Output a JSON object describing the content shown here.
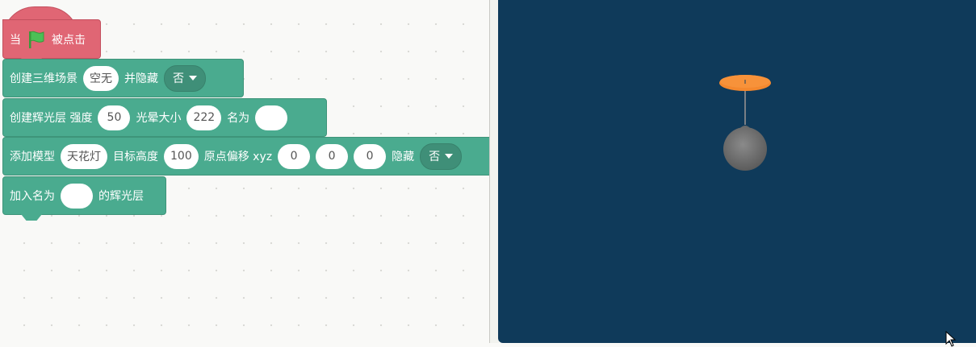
{
  "blocks": {
    "hat": {
      "prefix": "当",
      "suffix": "被点击",
      "flag_icon": "green-flag-icon",
      "color": "#e06674"
    },
    "scene": {
      "label": "创建三维场景",
      "scene_value": "空无",
      "hide_label": "并隐藏",
      "hide_value": "否"
    },
    "glow": {
      "label": "创建辉光层 强度",
      "strength": "50",
      "halo_label": "光晕大小",
      "halo": "222",
      "name_label": "名为",
      "name_value": ""
    },
    "model": {
      "label": "添加模型",
      "model_value": "天花灯",
      "height_label": "目标高度",
      "height": "100",
      "offset_label": "原点偏移 xyz",
      "x": "0",
      "y": "0",
      "z": "0",
      "hide_label": "隐藏",
      "hide_value": "否"
    },
    "join": {
      "label": "加入名为",
      "name_value": "",
      "suffix": "的辉光层"
    },
    "color": "#4aab8f"
  },
  "stage": {
    "background": "#0f3a5a",
    "object": "ceiling-lamp"
  }
}
